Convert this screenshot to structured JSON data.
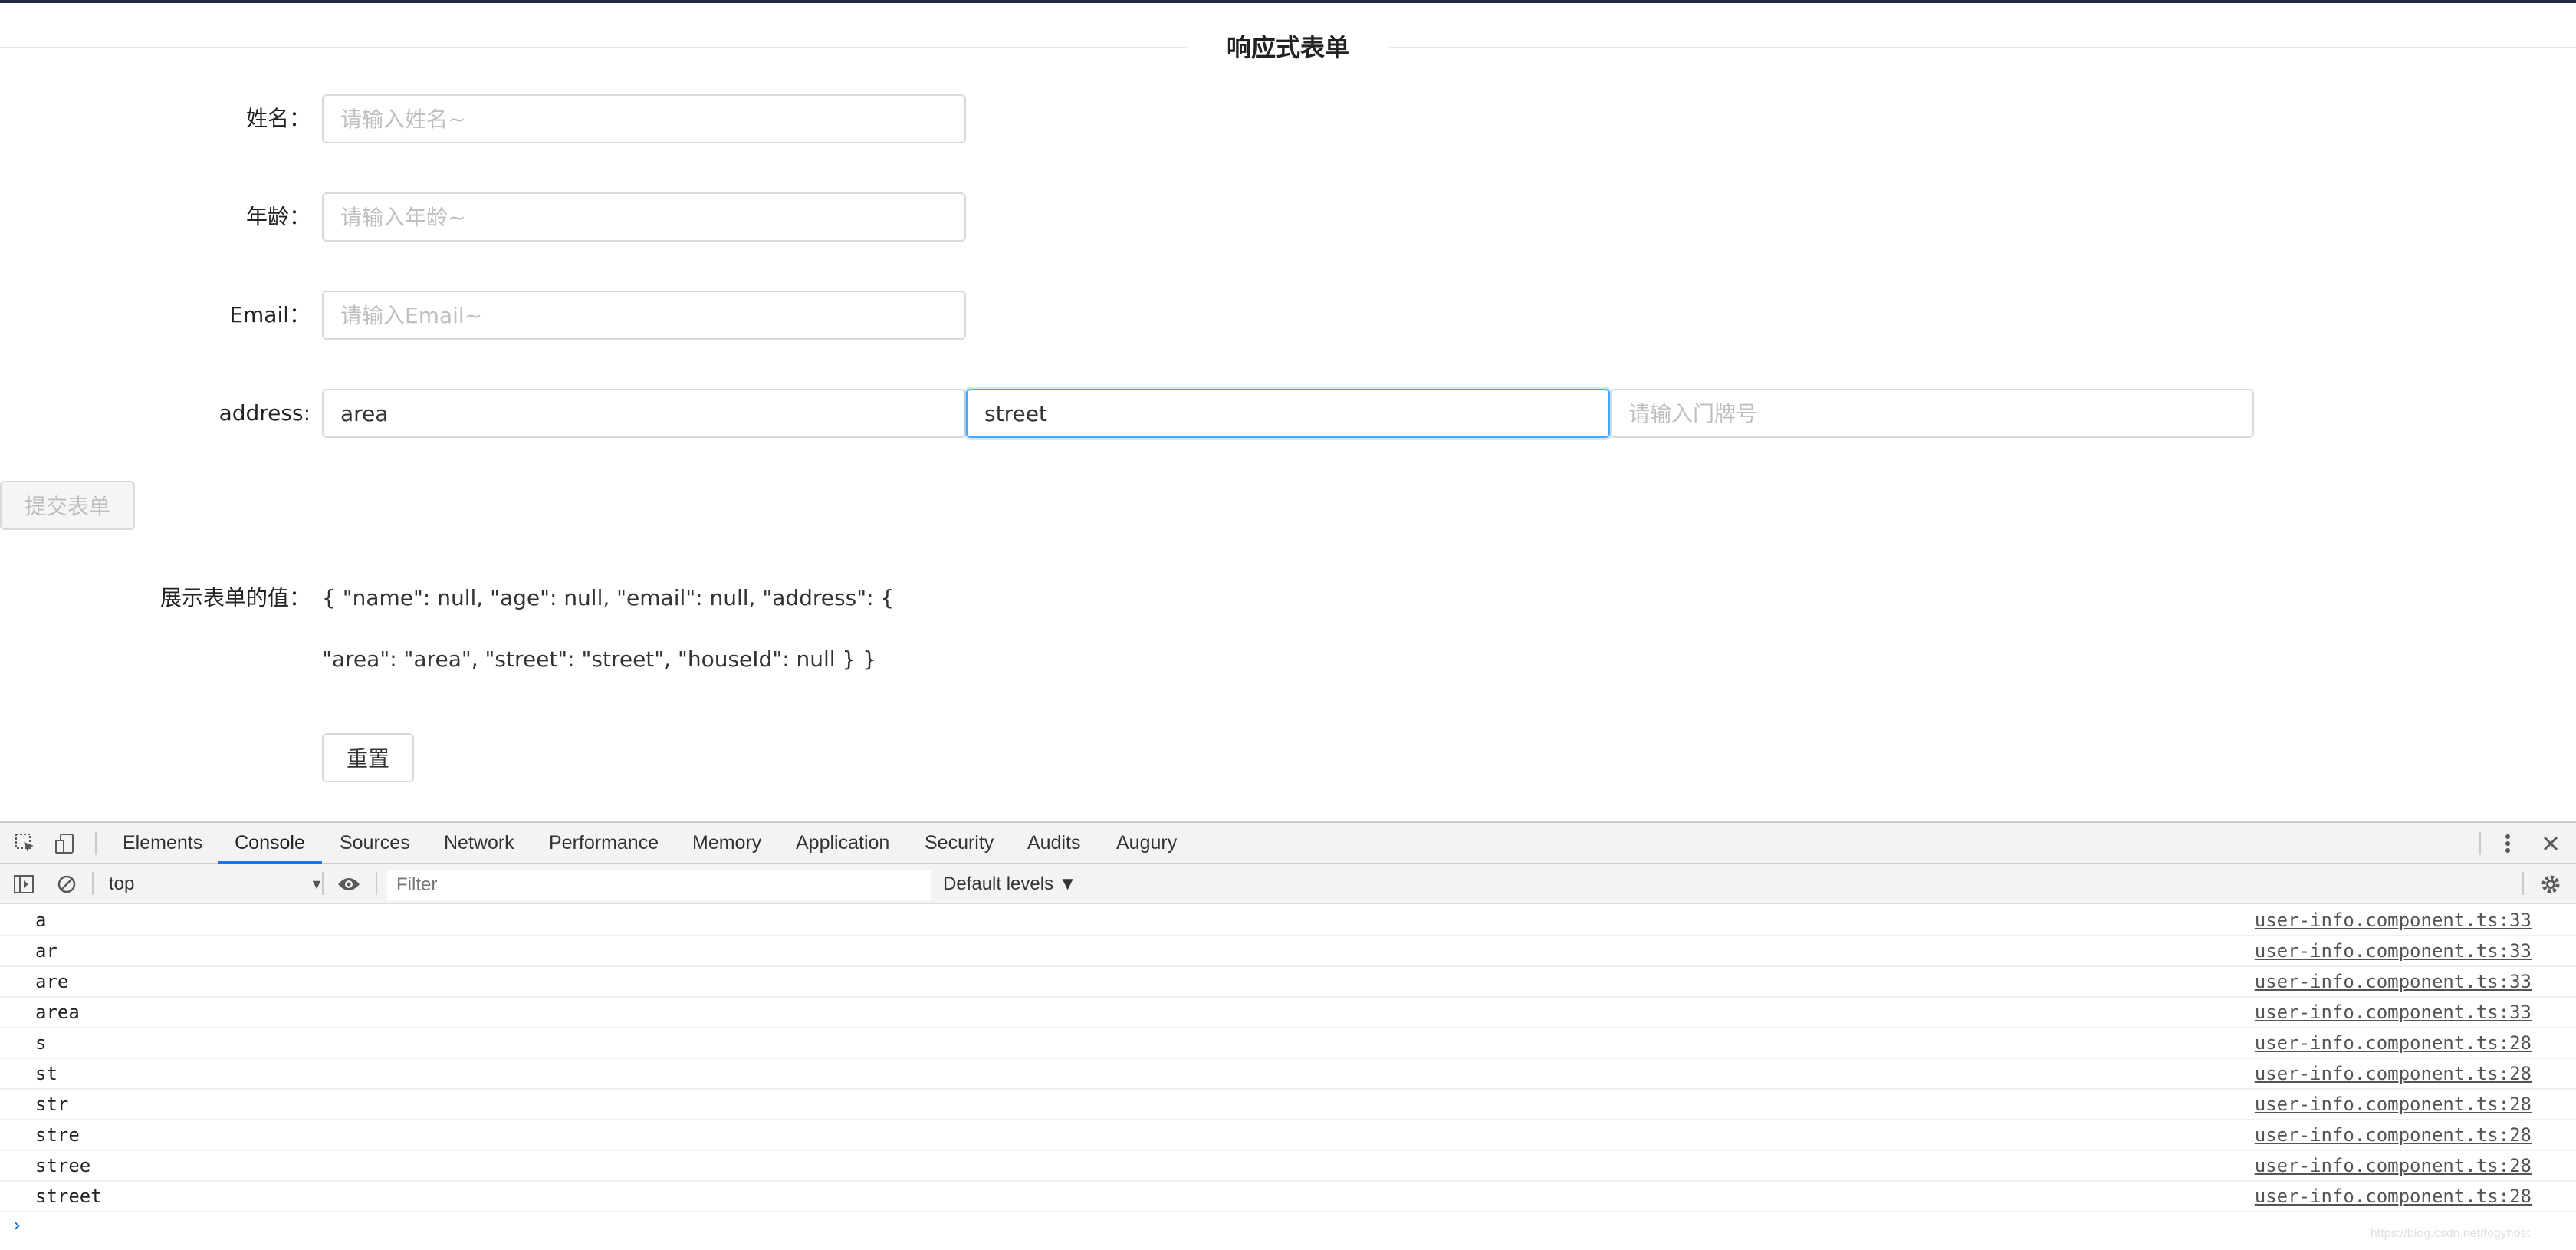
{
  "form": {
    "title": "响应式表单",
    "name_label": "姓名：",
    "name_placeholder": "请输入姓名~",
    "age_label": "年龄：",
    "age_placeholder": "请输入年龄~",
    "email_label": "Email：",
    "email_placeholder": "请输入Email~",
    "address_label": "address:",
    "area_value": "area",
    "street_value": "street",
    "house_placeholder": "请输入门牌号",
    "submit_label": "提交表单",
    "value_label": "展示表单的值：",
    "value_text": "{ \"name\": null, \"age\": null, \"email\": null, \"address\": { \"area\": \"area\", \"street\": \"street\", \"houseId\": null } }",
    "reset_label": "重置"
  },
  "devtools": {
    "tabs": [
      "Elements",
      "Console",
      "Sources",
      "Network",
      "Performance",
      "Memory",
      "Application",
      "Security",
      "Audits",
      "Augury"
    ],
    "active_tab": "Console",
    "context": "top",
    "filter_placeholder": "Filter",
    "levels": "Default levels ▼",
    "logs": [
      {
        "msg": "a",
        "src": "user-info.component.ts:33"
      },
      {
        "msg": "ar",
        "src": "user-info.component.ts:33"
      },
      {
        "msg": "are",
        "src": "user-info.component.ts:33"
      },
      {
        "msg": "area",
        "src": "user-info.component.ts:33"
      },
      {
        "msg": "s",
        "src": "user-info.component.ts:28"
      },
      {
        "msg": "st",
        "src": "user-info.component.ts:28"
      },
      {
        "msg": "str",
        "src": "user-info.component.ts:28"
      },
      {
        "msg": "stre",
        "src": "user-info.component.ts:28"
      },
      {
        "msg": "stree",
        "src": "user-info.component.ts:28"
      },
      {
        "msg": "street",
        "src": "user-info.component.ts:28"
      }
    ],
    "prompt": "›",
    "watermark": "https://blog.csdn.net/fogyhost"
  },
  "icons": {
    "inspect": "inspect-icon",
    "device": "device-toggle-icon",
    "more": "more-vertical-icon",
    "close": "close-icon",
    "sidebar": "sidebar-toggle-icon",
    "clear": "clear-console-icon",
    "eye": "eye-icon",
    "settings": "gear-icon"
  },
  "colors": {
    "focus_border": "#40a9ff",
    "active_tab": "#1a73e8"
  }
}
